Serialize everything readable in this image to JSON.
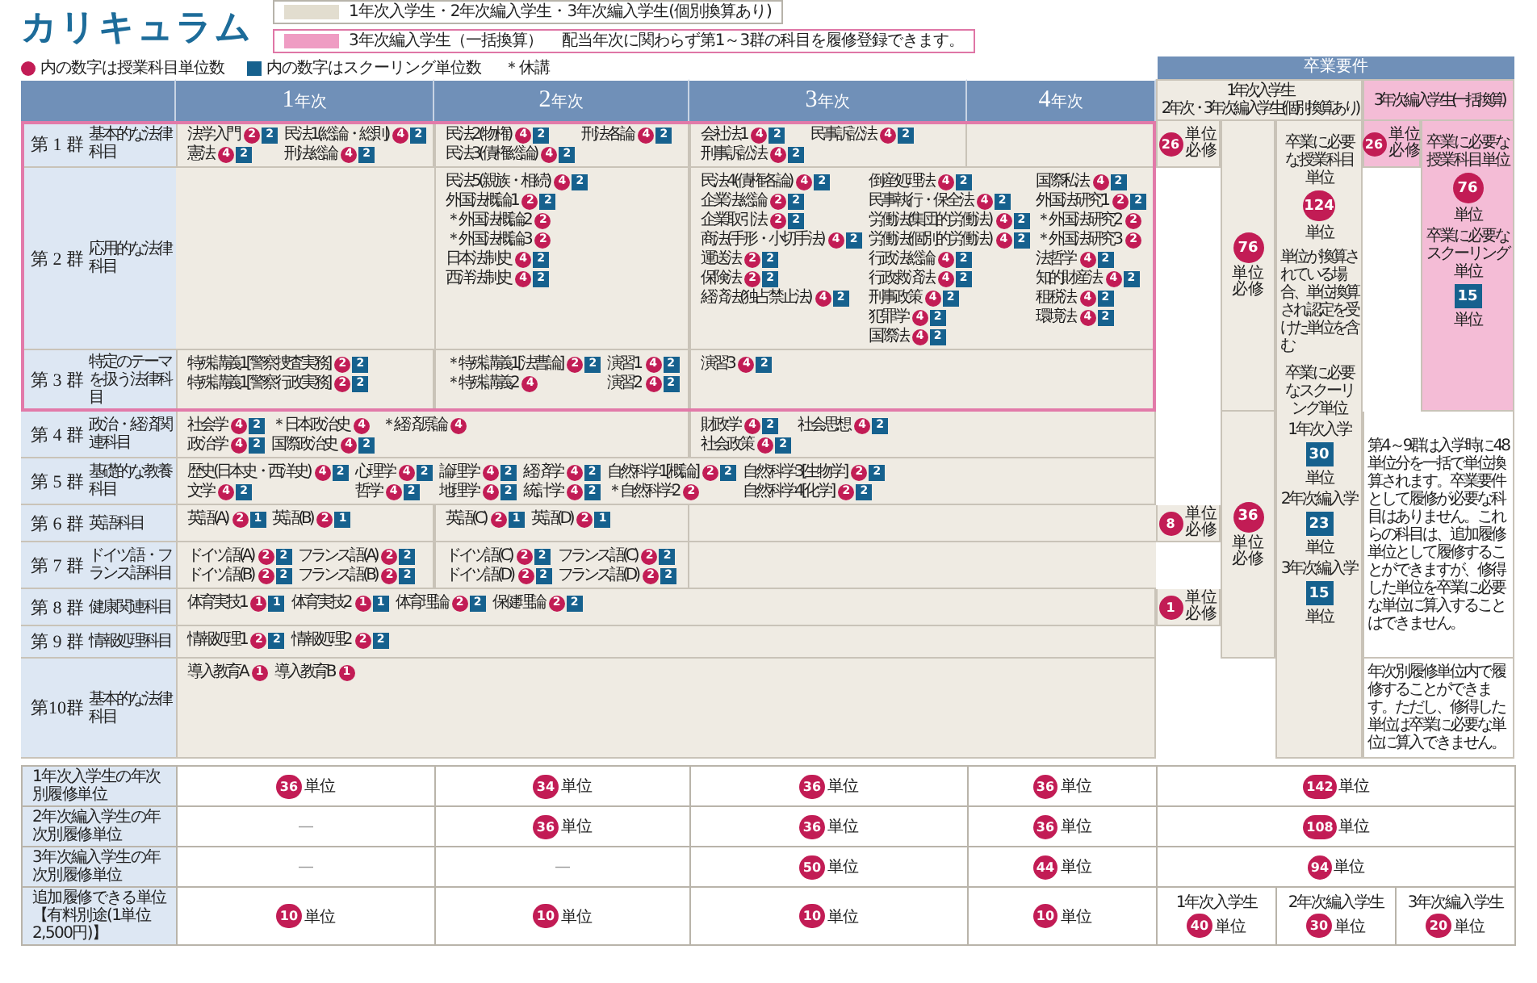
{
  "title": "カリキュラム",
  "legend": {
    "boxes": [
      {
        "kind": "beige",
        "text": "1年次入学生・2年次編入学生・3年次編入学生(個別換算あり)"
      },
      {
        "kind": "pink",
        "text": "3年次編入学生（一括換算）",
        "note": "配当年次に関わらず第1～3群の科目を履修登録できます。"
      }
    ],
    "marks": [
      {
        "kind": "circle",
        "text": "内の数字は授業科目単位数"
      },
      {
        "kind": "square",
        "text": "内の数字はスクーリング単位数"
      },
      {
        "kind": "plain",
        "text": "＊休講"
      }
    ]
  },
  "years": [
    {
      "number": "1",
      "suffix": "年次"
    },
    {
      "number": "2",
      "suffix": "年次"
    },
    {
      "number": "3",
      "suffix": "年次"
    },
    {
      "number": "4",
      "suffix": "年次"
    }
  ],
  "requirements": {
    "title": "卒業要件",
    "headers": [
      {
        "color": "#efebe3",
        "lines": [
          "1年次入学生",
          "2年次・3年次編入学生(個別換算あり)"
        ]
      },
      {
        "color": "#f4bcd6",
        "lines": [
          "3年次編入学生(一括換算)"
        ]
      }
    ],
    "cells": [
      {
        "color": "#efebe3",
        "kind": "required",
        "value": "26",
        "label": "単位必修"
      },
      {
        "color": "#efebe3",
        "kind": "required",
        "value": "8",
        "label": "単位必修"
      },
      {
        "color": "#efebe3",
        "kind": "required",
        "value": "1",
        "label": "単位必修"
      },
      {
        "color": "#efebe3",
        "kind": "stacked",
        "value": "76",
        "label": "単位必修"
      },
      {
        "color": "#efebe3",
        "kind": "stacked",
        "value": "36",
        "label": "単位必修"
      },
      {
        "color": "#efebe3",
        "kind": "summary",
        "blocks": [
          {
            "kind": "caption",
            "text": "卒業に必要な授業科目単位"
          },
          {
            "kind": "circle",
            "text": "124"
          },
          {
            "kind": "caption",
            "text": "単位"
          },
          {
            "kind": "small",
            "text": "単位が換算されている場合、単位換算され認定を受けた単位を含む"
          },
          {
            "kind": "caption",
            "text": "卒業に必要なスクーリング単位"
          },
          {
            "kind": "caption",
            "text": "1年次入学"
          },
          {
            "kind": "square",
            "text": "30"
          },
          {
            "kind": "caption",
            "text": "単位"
          },
          {
            "kind": "caption",
            "text": "2年次編入学"
          },
          {
            "kind": "square",
            "text": "23"
          },
          {
            "kind": "caption",
            "text": "単位"
          },
          {
            "kind": "caption",
            "text": "3年次編入学"
          },
          {
            "kind": "square",
            "text": "15"
          },
          {
            "kind": "caption",
            "text": "単位"
          }
        ]
      },
      {
        "color": "#f4bcd6",
        "kind": "required",
        "value": "26",
        "label": "単位必修"
      },
      {
        "color": "#f4bcd6",
        "kind": "summary",
        "blocks": [
          {
            "kind": "caption",
            "text": "卒業に必要な授業科目単位"
          },
          {
            "kind": "circle",
            "text": "76"
          },
          {
            "kind": "caption",
            "text": "単位"
          },
          {
            "kind": "caption",
            "text": "卒業に必要なスクーリング単位"
          },
          {
            "kind": "square",
            "text": "15"
          },
          {
            "kind": "caption",
            "text": "単位"
          }
        ]
      },
      {
        "color": "#ffffff",
        "kind": "note",
        "text": "第4～9群は入学時に48単位分を一括で単位換算されます。卒業要件として履修が必要な科目はありません。これらの科目は、追加履修単位として履修することができますが、修得した単位を卒業に必要な単位に算入することはできません。"
      },
      {
        "color": "#ffffff",
        "kind": "note",
        "text": "年次別履修単位内で履修することができます。ただし、修得した単位は卒業に必要な単位に算入できません。"
      }
    ]
  },
  "groups": [
    {
      "label": "第 1 群",
      "name": "基本的な法律科目",
      "highlighted": true,
      "cells": [
        {
          "columns": [
            [
              {
                "name": "法学入門",
                "lecture": "2",
                "schooling": "2"
              },
              {
                "name": "憲法",
                "lecture": "4",
                "schooling": "2"
              }
            ],
            [
              {
                "name": "民法1(総論・総則)",
                "lecture": "4",
                "schooling": "2"
              },
              {
                "name": "刑法総論",
                "lecture": "4",
                "schooling": "2"
              }
            ]
          ]
        },
        {
          "columns": [
            [
              {
                "name": "民法2(物権)",
                "lecture": "4",
                "schooling": "2"
              },
              {
                "name": "民法3(債権総論)",
                "lecture": "4",
                "schooling": "2"
              }
            ],
            [
              {
                "name": "刑法各論",
                "lecture": "4",
                "schooling": "2"
              }
            ]
          ]
        },
        {
          "columns": [
            [
              {
                "name": "会社法1",
                "lecture": "4",
                "schooling": "2"
              },
              {
                "name": "刑事訴訟法",
                "lecture": "4",
                "schooling": "2"
              }
            ],
            [
              {
                "name": "民事訴訟法",
                "lecture": "4",
                "schooling": "2"
              }
            ]
          ]
        }
      ]
    },
    {
      "label": "第 2 群",
      "name": "応用的な法律科目",
      "highlighted": true,
      "cells": [
        {
          "columns": [
            [
              {
                "name": "民法5(親族・相続)",
                "lecture": "4",
                "schooling": "2"
              },
              {
                "name": "外国法概論1",
                "lecture": "2",
                "schooling": "2"
              },
              {
                "name": "＊外国法概論2",
                "lecture": "2"
              },
              {
                "name": "＊外国法概論3",
                "lecture": "2"
              },
              {
                "name": "日本法制史",
                "lecture": "4",
                "schooling": "2"
              },
              {
                "name": "西洋法制史",
                "lecture": "4",
                "schooling": "2"
              }
            ]
          ]
        },
        {
          "columns": [
            [
              {
                "name": "民法4(債権各論)",
                "lecture": "4",
                "schooling": "2"
              },
              {
                "name": "企業法総論",
                "lecture": "2",
                "schooling": "2"
              },
              {
                "name": "企業取引法",
                "lecture": "2",
                "schooling": "2"
              },
              {
                "name": "商法(手形・小切手法)",
                "lecture": "4",
                "schooling": "2"
              },
              {
                "name": "運送法",
                "lecture": "2",
                "schooling": "2"
              },
              {
                "name": "保険法",
                "lecture": "2",
                "schooling": "2"
              },
              {
                "name": "経済法(独占禁止法)",
                "lecture": "4",
                "schooling": "2"
              }
            ],
            [
              {
                "name": "倒産処理法",
                "lecture": "4",
                "schooling": "2"
              },
              {
                "name": "民事執行・保全法",
                "lecture": "4",
                "schooling": "2"
              },
              {
                "name": "労働法(集団的労働法)",
                "lecture": "4",
                "schooling": "2"
              },
              {
                "name": "労働法(個別的労働法)",
                "lecture": "4",
                "schooling": "2"
              },
              {
                "name": "行政法総論",
                "lecture": "4",
                "schooling": "2"
              },
              {
                "name": "行政救済法",
                "lecture": "4",
                "schooling": "2"
              },
              {
                "name": "刑事政策",
                "lecture": "4",
                "schooling": "2"
              },
              {
                "name": "犯罪学",
                "lecture": "4",
                "schooling": "2"
              },
              {
                "name": "国際法",
                "lecture": "4",
                "schooling": "2"
              }
            ],
            [
              {
                "name": "国際私法",
                "lecture": "4",
                "schooling": "2"
              },
              {
                "name": "外国法研究1",
                "lecture": "2",
                "schooling": "2"
              },
              {
                "name": "＊外国法研究2",
                "lecture": "2"
              },
              {
                "name": "＊外国法研究3",
                "lecture": "2"
              },
              {
                "name": "法哲学",
                "lecture": "4",
                "schooling": "2"
              },
              {
                "name": "知的財産法",
                "lecture": "4",
                "schooling": "2"
              },
              {
                "name": "租税法",
                "lecture": "4",
                "schooling": "2"
              },
              {
                "name": "環境法",
                "lecture": "4",
                "schooling": "2"
              }
            ]
          ]
        }
      ]
    },
    {
      "label": "第 3 群",
      "name": "特定のテーマを扱う法律科目",
      "highlighted": true,
      "cells": [
        {
          "columns": [
            [
              {
                "name": "特殊講義1[警察捜査実務]",
                "lecture": "2",
                "schooling": "2"
              },
              {
                "name": "特殊講義1[警察行政実務]",
                "lecture": "2",
                "schooling": "2"
              }
            ]
          ]
        },
        {
          "columns": [
            [
              {
                "name": "＊特殊講義1[法曹論]",
                "lecture": "2",
                "schooling": "2"
              },
              {
                "name": "＊特殊講義2",
                "lecture": "4"
              }
            ],
            [
              {
                "name": "演習1",
                "lecture": "4",
                "schooling": "2"
              },
              {
                "name": "演習2",
                "lecture": "4",
                "schooling": "2"
              }
            ]
          ]
        },
        {
          "columns": [
            [
              {
                "name": "演習3",
                "lecture": "4",
                "schooling": "2"
              }
            ]
          ]
        }
      ]
    },
    {
      "label": "第 4 群",
      "name": "政治・経済関連科目",
      "highlighted": false,
      "cells": [
        {
          "columns": [
            [
              {
                "name": "社会学",
                "lecture": "4",
                "schooling": "2"
              },
              {
                "name": "政治学",
                "lecture": "4",
                "schooling": "2"
              }
            ],
            [
              {
                "name": "＊日本政治史",
                "lecture": "4"
              },
              {
                "name": "国際政治史",
                "lecture": "4",
                "schooling": "2"
              }
            ],
            [
              {
                "name": "＊経済原論",
                "lecture": "4"
              }
            ]
          ]
        },
        {
          "columns": [
            [
              {
                "name": "財政学",
                "lecture": "4",
                "schooling": "2"
              },
              {
                "name": "社会政策",
                "lecture": "4",
                "schooling": "2"
              }
            ],
            [
              {
                "name": "社会思想",
                "lecture": "4",
                "schooling": "2"
              }
            ]
          ]
        }
      ]
    },
    {
      "label": "第 5 群",
      "name": "基礎的な教養科目",
      "highlighted": false,
      "cells": [
        {
          "columns": [
            [
              {
                "name": "歴史(日本史・西洋史)",
                "lecture": "4",
                "schooling": "2"
              },
              {
                "name": "文学",
                "lecture": "4",
                "schooling": "2"
              }
            ],
            [
              {
                "name": "心理学",
                "lecture": "4",
                "schooling": "2"
              },
              {
                "name": "哲学",
                "lecture": "4",
                "schooling": "2"
              }
            ],
            [
              {
                "name": "論理学",
                "lecture": "4",
                "schooling": "2"
              },
              {
                "name": "地理学",
                "lecture": "4",
                "schooling": "2"
              }
            ],
            [
              {
                "name": "経済学",
                "lecture": "4",
                "schooling": "2"
              },
              {
                "name": "統計学",
                "lecture": "4",
                "schooling": "2"
              }
            ],
            [
              {
                "name": "自然科学1[概論]",
                "lecture": "2",
                "schooling": "2"
              },
              {
                "name": "＊自然科学2",
                "lecture": "2"
              }
            ],
            [
              {
                "name": "自然科学3[生物学]",
                "lecture": "2",
                "schooling": "2"
              },
              {
                "name": "自然科学4[化学]",
                "lecture": "2",
                "schooling": "2"
              }
            ]
          ]
        }
      ]
    },
    {
      "label": "第 6 群",
      "name": "英語科目",
      "highlighted": false,
      "cells": [
        {
          "columns": [
            [
              {
                "name": "英語(A)",
                "lecture": "2",
                "schooling": "1"
              }
            ],
            [
              {
                "name": "英語(B)",
                "lecture": "2",
                "schooling": "1"
              }
            ]
          ]
        },
        {
          "columns": [
            [
              {
                "name": "英語(C)",
                "lecture": "2",
                "schooling": "1"
              }
            ],
            [
              {
                "name": "英語(D)",
                "lecture": "2",
                "schooling": "1"
              }
            ]
          ]
        }
      ]
    },
    {
      "label": "第 7 群",
      "name": "ドイツ語・フランス語科目",
      "highlighted": false,
      "cells": [
        {
          "columns": [
            [
              {
                "name": "ドイツ語(A)",
                "lecture": "2",
                "schooling": "2"
              },
              {
                "name": "ドイツ語(B)",
                "lecture": "2",
                "schooling": "2"
              }
            ],
            [
              {
                "name": "フランス語(A)",
                "lecture": "2",
                "schooling": "2"
              },
              {
                "name": "フランス語(B)",
                "lecture": "2",
                "schooling": "2"
              }
            ]
          ]
        },
        {
          "columns": [
            [
              {
                "name": "ドイツ語(C)",
                "lecture": "2",
                "schooling": "2"
              },
              {
                "name": "ドイツ語(D)",
                "lecture": "2",
                "schooling": "2"
              }
            ],
            [
              {
                "name": "フランス語(C)",
                "lecture": "2",
                "schooling": "2"
              },
              {
                "name": "フランス語(D)",
                "lecture": "2",
                "schooling": "2"
              }
            ]
          ]
        }
      ]
    },
    {
      "label": "第 8 群",
      "name": "健康関連科目",
      "highlighted": false,
      "cells": [
        {
          "columns": [
            [
              {
                "name": "体育実技1",
                "lecture": "1",
                "schooling": "1"
              }
            ],
            [
              {
                "name": "体育実技2",
                "lecture": "1",
                "schooling": "1"
              }
            ],
            [
              {
                "name": "体育理論",
                "lecture": "2",
                "schooling": "2"
              }
            ],
            [
              {
                "name": "保健理論",
                "lecture": "2",
                "schooling": "2"
              }
            ]
          ]
        }
      ]
    },
    {
      "label": "第 9 群",
      "name": "情報処理科目",
      "highlighted": false,
      "cells": [
        {
          "columns": [
            [
              {
                "name": "情報処理1",
                "lecture": "2",
                "schooling": "2"
              }
            ],
            [
              {
                "name": "情報処理2",
                "lecture": "2",
                "schooling": "2"
              }
            ]
          ]
        }
      ]
    },
    {
      "label": "第10群",
      "name": "基本的な法律科目",
      "highlighted": false,
      "cells": [
        {
          "columns": [
            [
              {
                "name": "導入教育A",
                "lecture": "1"
              }
            ],
            [
              {
                "name": "導入教育B",
                "lecture": "1"
              }
            ]
          ]
        }
      ]
    }
  ],
  "annual": {
    "rows": [
      {
        "label": "1年次入学生の年次別履修単位",
        "cells": [
          {
            "kind": "credit",
            "value": "36",
            "unit": "単位"
          },
          {
            "kind": "credit",
            "value": "34",
            "unit": "単位"
          },
          {
            "kind": "credit",
            "value": "36",
            "unit": "単位"
          },
          {
            "kind": "credit",
            "value": "36",
            "unit": "単位"
          },
          {
            "kind": "credit",
            "value": "142",
            "unit": "単位"
          }
        ]
      },
      {
        "label": "2年次編入学生の年次別履修単位",
        "cells": [
          {
            "kind": "dash",
            "value": "—"
          },
          {
            "kind": "credit",
            "value": "36",
            "unit": "単位"
          },
          {
            "kind": "credit",
            "value": "36",
            "unit": "単位"
          },
          {
            "kind": "credit",
            "value": "36",
            "unit": "単位"
          },
          {
            "kind": "credit",
            "value": "108",
            "unit": "単位"
          }
        ]
      },
      {
        "label": "3年次編入学生の年次別履修単位",
        "cells": [
          {
            "kind": "dash",
            "value": "—"
          },
          {
            "kind": "dash",
            "value": "—"
          },
          {
            "kind": "credit",
            "value": "50",
            "unit": "単位"
          },
          {
            "kind": "credit",
            "value": "44",
            "unit": "単位"
          },
          {
            "kind": "credit",
            "value": "94",
            "unit": "単位"
          }
        ]
      },
      {
        "label": "追加履修できる単位【有料別途(1単位2,500円)】",
        "cells": [
          {
            "kind": "credit",
            "value": "10",
            "unit": "単位"
          },
          {
            "kind": "credit",
            "value": "10",
            "unit": "単位"
          },
          {
            "kind": "credit",
            "value": "10",
            "unit": "単位"
          },
          {
            "kind": "credit",
            "value": "10",
            "unit": "単位"
          },
          {
            "kind": "labeled",
            "label": "1年次入学生",
            "value": "40",
            "unit": "単位"
          },
          {
            "kind": "labeled",
            "label": "2年次編入学生",
            "value": "30",
            "unit": "単位"
          },
          {
            "kind": "labeled",
            "label": "3年次編入学生",
            "value": "20",
            "unit": "単位"
          }
        ]
      }
    ]
  }
}
